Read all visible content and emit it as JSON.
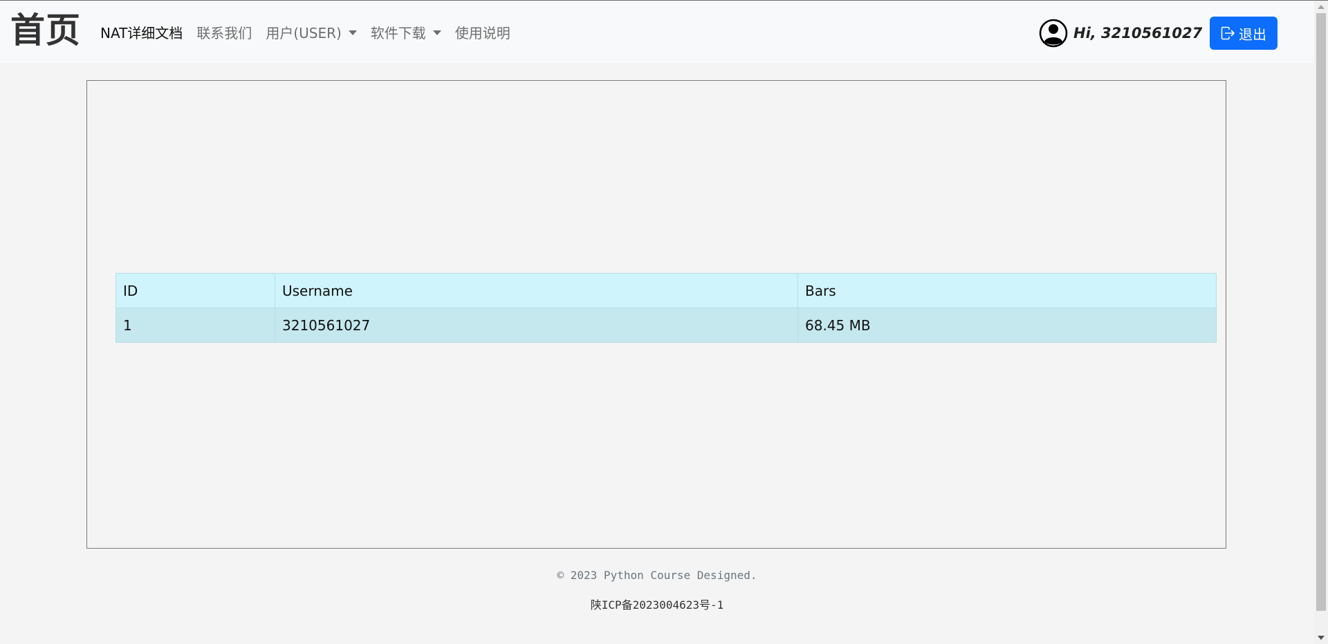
{
  "navbar": {
    "brand": "首页",
    "links": [
      {
        "label": "NAT详细文档",
        "active": true,
        "dropdown": false
      },
      {
        "label": "联系我们",
        "active": false,
        "dropdown": false
      },
      {
        "label": "用户(USER)",
        "active": false,
        "dropdown": true
      },
      {
        "label": "软件下载",
        "active": false,
        "dropdown": true
      },
      {
        "label": "使用说明",
        "active": false,
        "dropdown": false
      }
    ],
    "avatar_icon": "person-circle-icon",
    "greeting": "Hi, 3210561027",
    "logout_icon": "box-arrow-right-icon",
    "logout_label": "退出",
    "logout_color": "#0d6efd"
  },
  "table": {
    "headers": [
      "ID",
      "Username",
      "Bars"
    ],
    "rows": [
      [
        "1",
        "3210561027",
        "68.45 MB"
      ]
    ],
    "header_bg": "#cff4fc",
    "row_bg": "#c5e8ee"
  },
  "footer": {
    "copyright": "© 2023 Python Course Designed.",
    "icp": "陕ICP备2023004623号-1"
  }
}
